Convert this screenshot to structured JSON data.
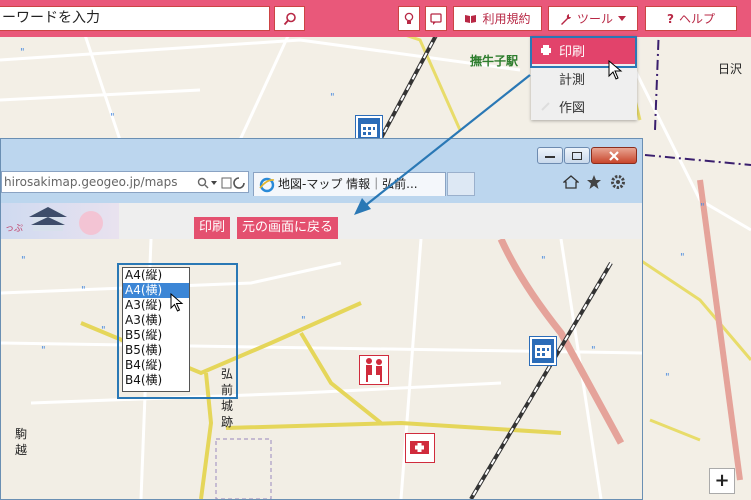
{
  "topbar": {
    "search_placeholder": "ーワードを入力",
    "terms_label": "利用規約",
    "tools_label": "ツール",
    "help_label": "ヘルプ"
  },
  "tools_menu": {
    "items": [
      {
        "label": "印刷",
        "icon": "printer-icon"
      },
      {
        "label": "計測",
        "icon": "ruler-icon"
      },
      {
        "label": "作図",
        "icon": "pencil-icon"
      }
    ]
  },
  "map_labels": {
    "station": "撫牛子駅",
    "hinatsuka": "日沢",
    "castle": "弘前城跡",
    "komagoshi": "駒越"
  },
  "browser": {
    "address": "hirosakimap.geogeo.jp/maps",
    "tab_title": "地図-マップ 情報｜弘前...",
    "logo_text": "っぷ"
  },
  "print_page": {
    "paper_options": [
      "A4(縦)",
      "A4(横)",
      "A3(縦)",
      "A3(横)",
      "B5(縦)",
      "B5(横)",
      "B4(縦)",
      "B4(横)"
    ],
    "selected_index": 1,
    "print_button": "印刷",
    "back_button": "元の画面に戻る"
  },
  "zoom": {
    "plus": "+"
  },
  "colors": {
    "accent": "#e9587a",
    "highlight": "#2a78b5",
    "selected": "#3c86d6"
  }
}
